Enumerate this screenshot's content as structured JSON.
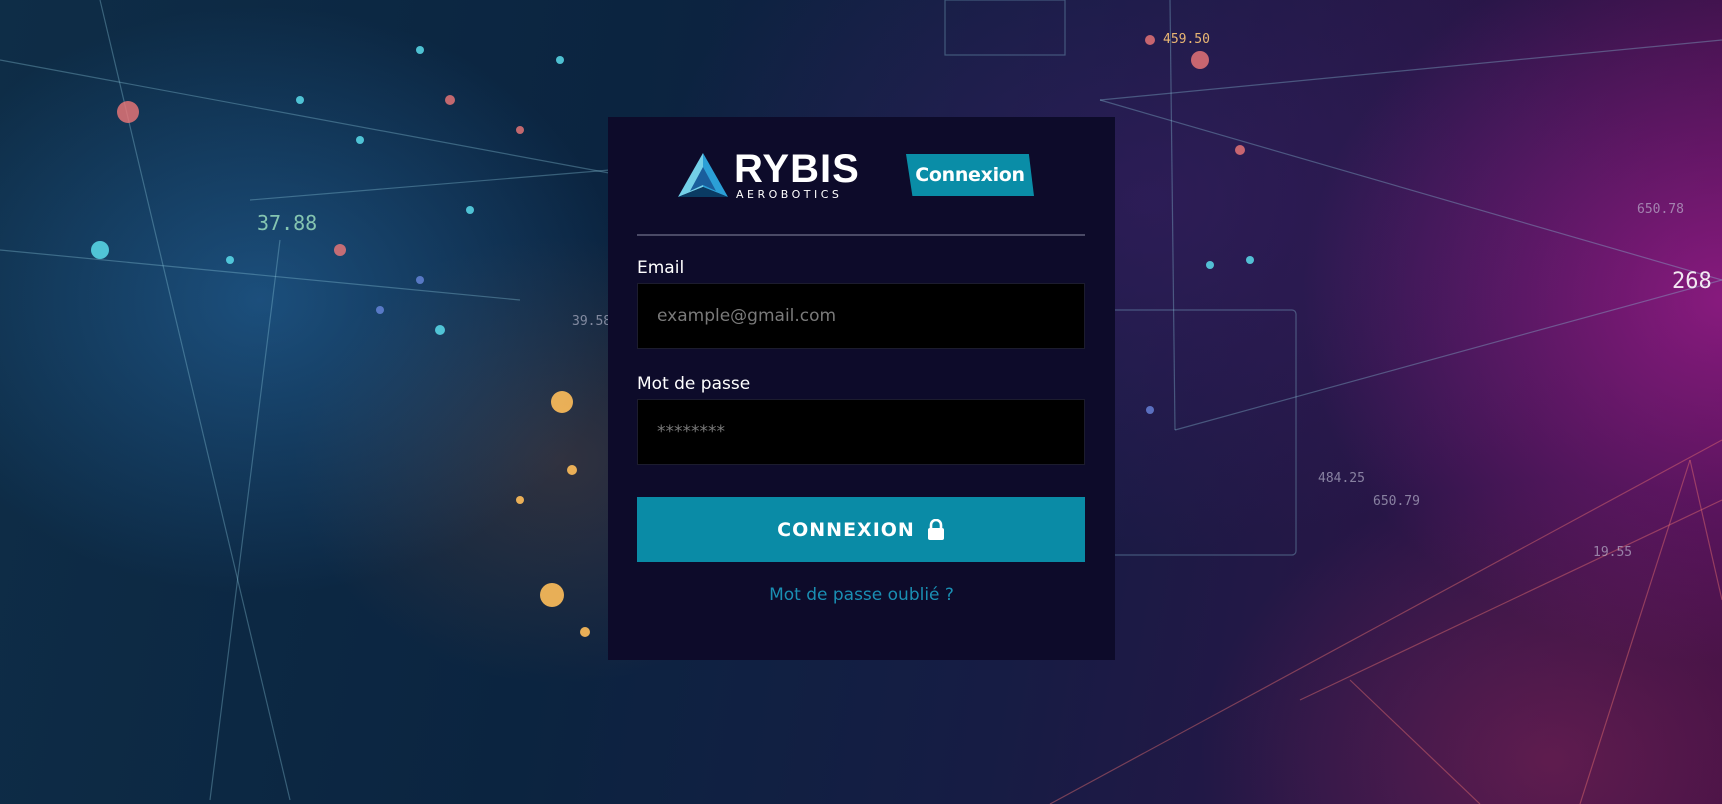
{
  "brand": {
    "name": "RYBIS",
    "tagline": "AEROBOTICS"
  },
  "header": {
    "badge_label": "Connexion"
  },
  "form": {
    "email_label": "Email",
    "email_placeholder": "example@gmail.com",
    "password_label": "Mot de passe",
    "password_placeholder": "********",
    "submit_label": "CONNEXION",
    "forgot_label": "Mot de passe oublié ?"
  },
  "background_readouts": [
    "37.88",
    "459.50",
    "268",
    "650.78",
    "484.25",
    "650.79",
    "39.58",
    "19.55"
  ],
  "colors": {
    "accent": "#0a8ba6",
    "card": "#0d0b2a",
    "link": "#1a8fb3",
    "input_bg": "#000000"
  },
  "icons": {
    "logo": "triangle-logo-icon",
    "submit": "lock-icon"
  }
}
